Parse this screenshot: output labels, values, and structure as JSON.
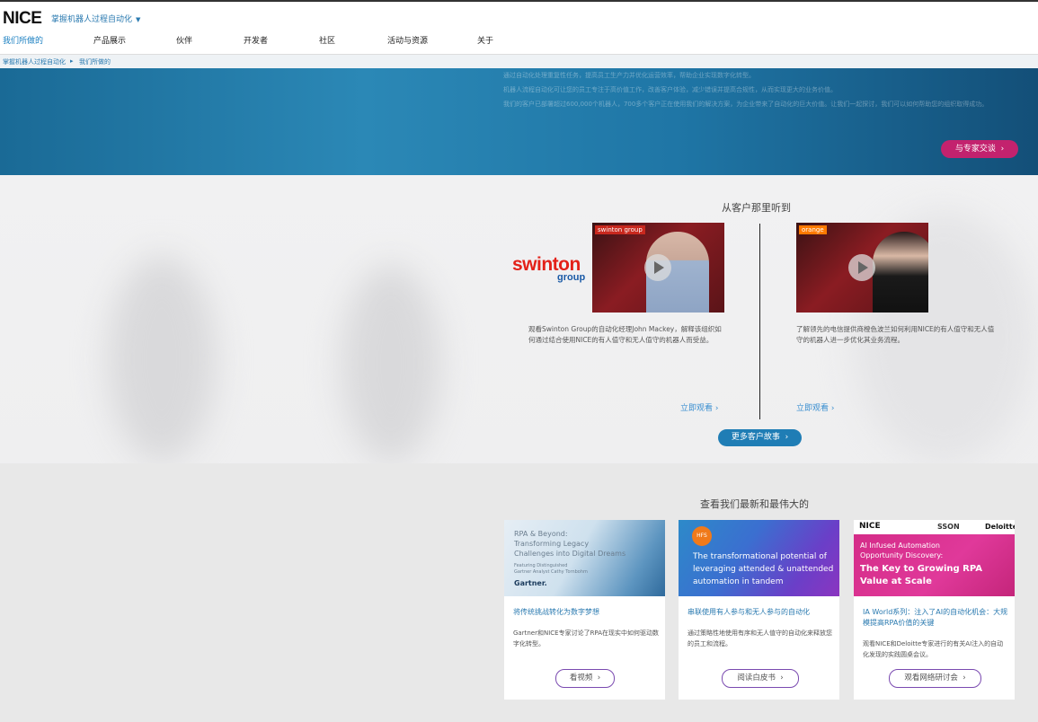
{
  "header": {
    "logo": "NICE",
    "product_menu": "掌握机器人过程自动化",
    "product_caret": "▼"
  },
  "nav": {
    "items": [
      "我们所做的",
      "产品展示",
      "伙伴",
      "开发者",
      "社区",
      "活动与资源",
      "关于"
    ]
  },
  "breadcrumb": {
    "items": [
      "掌握机器人过程自动化",
      "我们所做的"
    ],
    "separator": "▸"
  },
  "hero": {
    "lines": [
      "通过自动化处理重复性任务，提高员工生产力并优化运营效率，帮助企业实现数字化转型。",
      "机器人流程自动化可让您的员工专注于高价值工作，改善客户体验，减少错误并提高合规性，从而实现更大的业务价值。",
      "我们的客户已部署超过600,000个机器人，700多个客户正在使用我们的解决方案，为企业带来了自动化的巨大价值。让我们一起探讨，我们可以如何帮助您的组织取得成功。"
    ],
    "expert_button": "与专家交谈"
  },
  "customers": {
    "title": "从客户那里听到",
    "items": [
      {
        "logo_main": "swinton",
        "logo_sub": "group",
        "video_tag": "swinton group",
        "description": "观看Swinton Group的自动化经理John Mackey，解释该组织如何通过结合使用NICE的有人值守和无人值守的机器人而受益。",
        "link": "立即观看 ›"
      },
      {
        "video_tag": "orange",
        "description": "了解领先的电信提供商橙色波兰如何利用NICE的有人值守和无人值守的机器人进一步优化其业务流程。",
        "link": "立即观看 ›"
      }
    ],
    "more_button": "更多客户故事"
  },
  "latest": {
    "title": "查看我们最新和最伟大的",
    "cards": [
      {
        "image_lines": [
          "RPA & Beyond:",
          "Transforming Legacy",
          "Challenges into Digital Dreams"
        ],
        "image_sub": [
          "Featuring Distinguished",
          "Gartner Analyst Cathy Tornbohm"
        ],
        "image_brand": "Gartner.",
        "title": "将传统挑战转化为数字梦想",
        "description": "Gartner和NICE专家讨论了RPA在现实中如何驱动数字化转型。",
        "button": "看视频"
      },
      {
        "image_badge": "HFS",
        "image_lines": [
          "The transformational potential of",
          "leveraging attended & unattended",
          "automation in tandem"
        ],
        "title": "串联使用有人参与和无人参与的自动化",
        "description": "通过策略性地使用有序和无人值守的自动化来释放您的员工和流程。",
        "button": "阅读白皮书"
      },
      {
        "image_brands": [
          "NICE",
          "SSON",
          "Deloitte."
        ],
        "image_lines": [
          "AI Infused Automation",
          "Opportunity Discovery:"
        ],
        "image_bold": [
          "The Key to Growing RPA",
          "Value at Scale"
        ],
        "title": "IA World系列：注入了AI的自动化机会：大规模提高RPA价值的关键",
        "description": "观看NICE和Deloitte专家进行的有关AI注入的自动化发现的实践圆桌会议。",
        "button": "观看网络研讨会"
      }
    ]
  },
  "colors": {
    "brand_blue": "#1f7db5",
    "link_blue": "#2a7ab0",
    "magenta": "#c3226e",
    "purple_outline": "#7a4ab0"
  }
}
